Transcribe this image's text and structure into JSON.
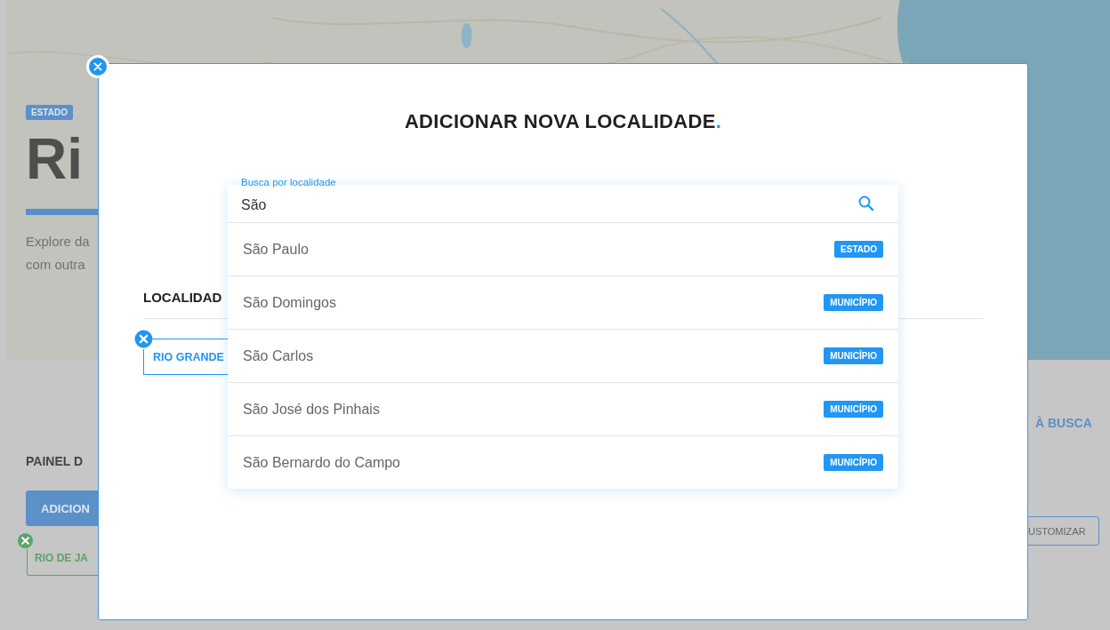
{
  "background": {
    "badge": "ESTADO",
    "title": "Ri",
    "description_lines": [
      "Explore da",
      "com outra"
    ],
    "panel_heading": "PAINEL D",
    "add_button": "ADICION",
    "saved_chips": [
      {
        "label": "RIO DE JA",
        "color": "#5aa469"
      }
    ],
    "back_link": "À BUSCA",
    "customize_button": "USTOMIZAR"
  },
  "modal": {
    "title": "ADICIONAR NOVA LOCALIDADE",
    "title_accent": ".",
    "section_heading": "LOCALIDAD",
    "chips": [
      {
        "label": "RIO GRANDE",
        "color": "#2196f3"
      }
    ],
    "search": {
      "label": "Busca por localidade",
      "value": "São"
    },
    "results": [
      {
        "name": "São Paulo",
        "type": "ESTADO"
      },
      {
        "name": "São Domingos",
        "type": "MUNICÍPIO"
      },
      {
        "name": "São Carlos",
        "type": "MUNICÍPIO"
      },
      {
        "name": "São José dos Pinhais",
        "type": "MUNICÍPIO"
      },
      {
        "name": "São Bernardo do Campo",
        "type": "MUNICÍPIO"
      }
    ]
  }
}
